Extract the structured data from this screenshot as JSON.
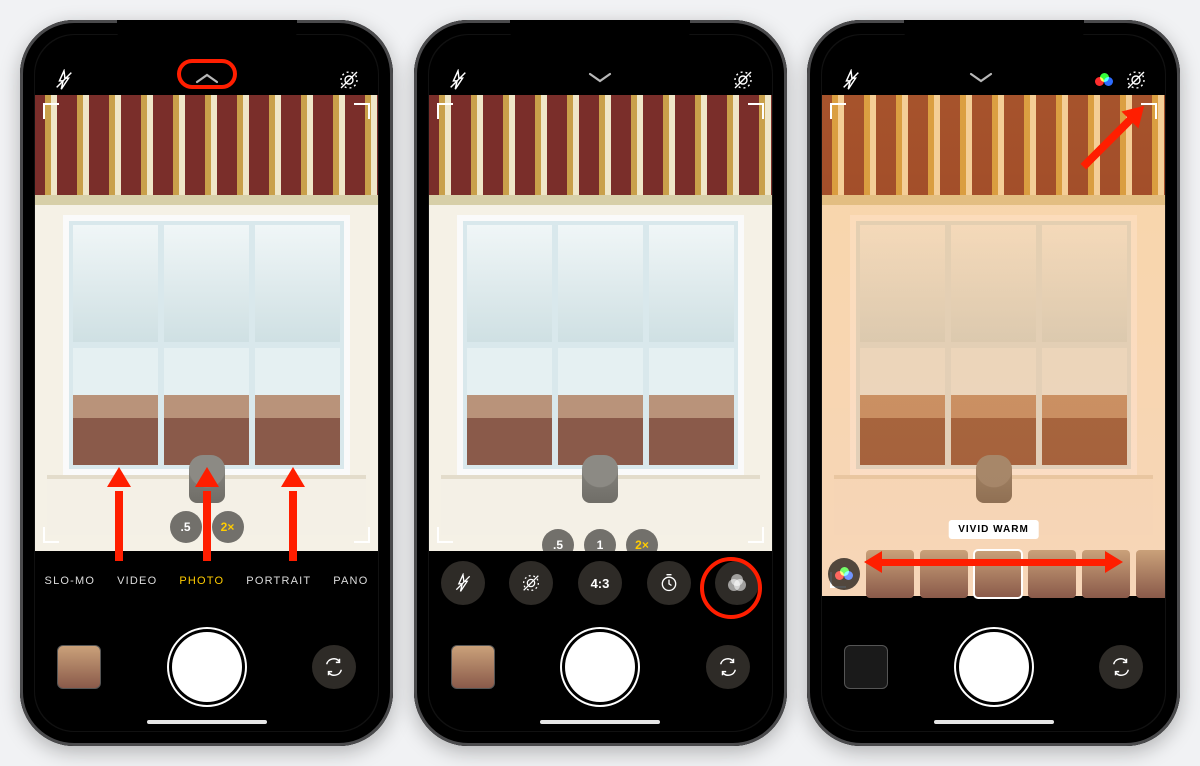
{
  "phones": {
    "p1": {
      "flash_state": "off",
      "live_state": "off",
      "chevron_dir": "up",
      "zoom": {
        "wide": ".5",
        "tele": "2×",
        "active": "tele"
      },
      "modes": [
        "SLO-MO",
        "VIDEO",
        "PHOTO",
        "PORTRAIT",
        "PANO"
      ],
      "active_mode": "PHOTO"
    },
    "p2": {
      "chevron_dir": "down",
      "zoom": {
        "wide": ".5",
        "std": "1",
        "tele": "2×",
        "active": "tele"
      },
      "tools": {
        "aspect_label": "4:3"
      }
    },
    "p3": {
      "chevron_dir": "down",
      "filter_label": "VIVID WARM",
      "filter_indicator_visible": true
    }
  },
  "annotations": {
    "p1_circle": "chevron-indicator",
    "p1_arrows": "swipe-up-from-modes",
    "p2_circle": "filters-tool",
    "p3_arrow": "filter-active-indicator",
    "p3_dbl": "swipe-filter-strip"
  }
}
